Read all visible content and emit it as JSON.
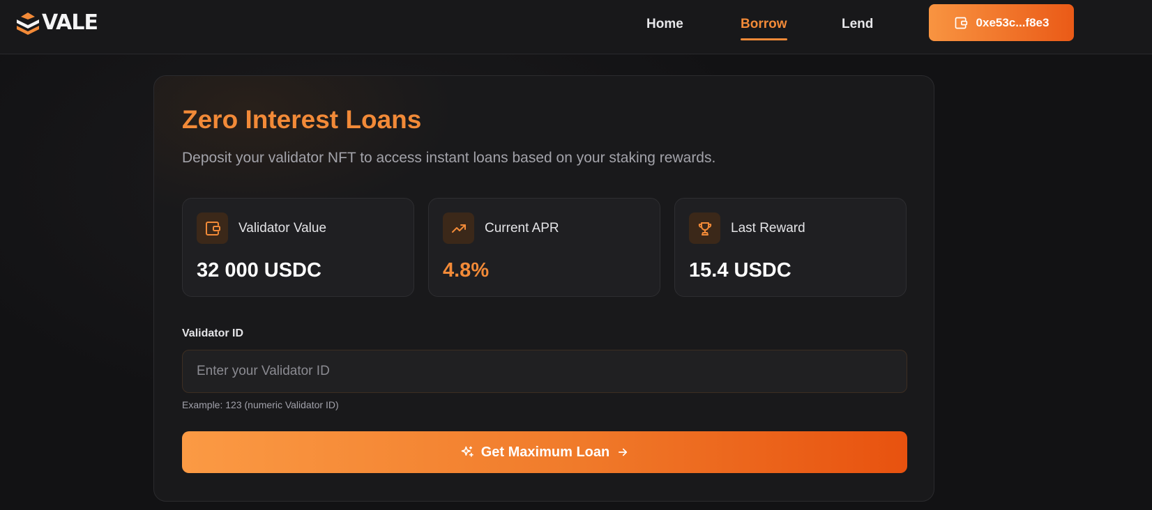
{
  "brand": {
    "name": "VALE"
  },
  "nav": {
    "links": [
      {
        "label": "Home"
      },
      {
        "label": "Borrow",
        "active": true
      },
      {
        "label": "Lend"
      }
    ],
    "wallet": {
      "address": "0xe53c...f8e3",
      "icon": "wallet-icon"
    }
  },
  "colors": {
    "accent": "#f28a38",
    "cta_start": "#fb9a44",
    "cta_end": "#e8520f"
  },
  "card": {
    "title": "Zero Interest Loans",
    "subtitle": "Deposit your validator NFT to access instant loans based on your staking rewards.",
    "stats": [
      {
        "label": "Validator Value",
        "value": "32 000 USDC",
        "icon": "wallet-icon"
      },
      {
        "label": "Current APR",
        "value": "4.8%",
        "icon": "trending-up-icon"
      },
      {
        "label": "Last Reward",
        "value": "15.4 USDC",
        "icon": "trophy-icon"
      }
    ],
    "validator_field": {
      "label": "Validator ID",
      "placeholder": "Enter your Validator ID",
      "value": "",
      "hint": "Example: 123 (numeric Validator ID)"
    },
    "cta": {
      "label": "Get Maximum Loan",
      "icon_left": "sparkles-icon",
      "icon_right": "arrow-right-icon"
    }
  }
}
